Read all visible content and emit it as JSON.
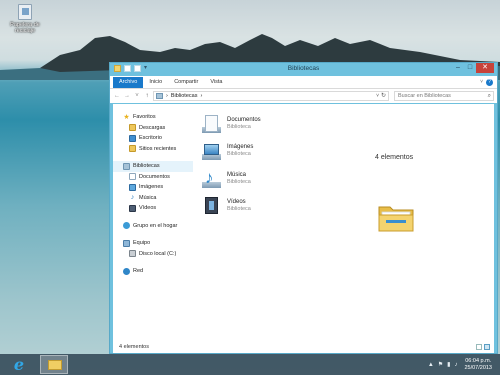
{
  "desktop": {
    "icons": [
      {
        "label": "Papelera de reciclaje",
        "icon": "recycle-bin-icon"
      }
    ]
  },
  "window": {
    "title": "Bibliotecas",
    "controls": {
      "minimize": "–",
      "maximize": "□",
      "close": "✕"
    }
  },
  "ribbon": {
    "tabs": [
      "Archivo",
      "Inicio",
      "Compartir",
      "Vista"
    ],
    "help": "?"
  },
  "address": {
    "back": "←",
    "forward": "→",
    "recent": "˅",
    "up": "↑",
    "path": "Bibliotecas",
    "separator": "›",
    "search_placeholder": "Buscar en Bibliotecas"
  },
  "nav": {
    "favorites": {
      "label": "Favoritos",
      "items": [
        "Descargas",
        "Escritorio",
        "Sitios recientes"
      ]
    },
    "libraries": {
      "label": "Bibliotecas",
      "items": [
        "Documentos",
        "Imágenes",
        "Música",
        "Vídeos"
      ]
    },
    "homegroup": "Grupo en el hogar",
    "computer": {
      "label": "Equipo",
      "items": [
        "Disco local (C:)"
      ]
    },
    "network": "Red"
  },
  "files": [
    {
      "name": "Documentos",
      "sub": "Biblioteca",
      "icon": "documents-library-icon"
    },
    {
      "name": "Imágenes",
      "sub": "Biblioteca",
      "icon": "pictures-library-icon"
    },
    {
      "name": "Música",
      "sub": "Biblioteca",
      "icon": "music-library-icon"
    },
    {
      "name": "Vídeos",
      "sub": "Biblioteca",
      "icon": "videos-library-icon"
    }
  ],
  "preview": {
    "count": "4 elementos"
  },
  "status": {
    "count": "4 elementos"
  },
  "taskbar": {
    "time": "06:04 p.m.",
    "date": "25/07/2013"
  },
  "colors": {
    "accent": "#1979ca",
    "window_frame": "#6fc1de",
    "close": "#c7423a",
    "taskbar": "#384e5c"
  }
}
